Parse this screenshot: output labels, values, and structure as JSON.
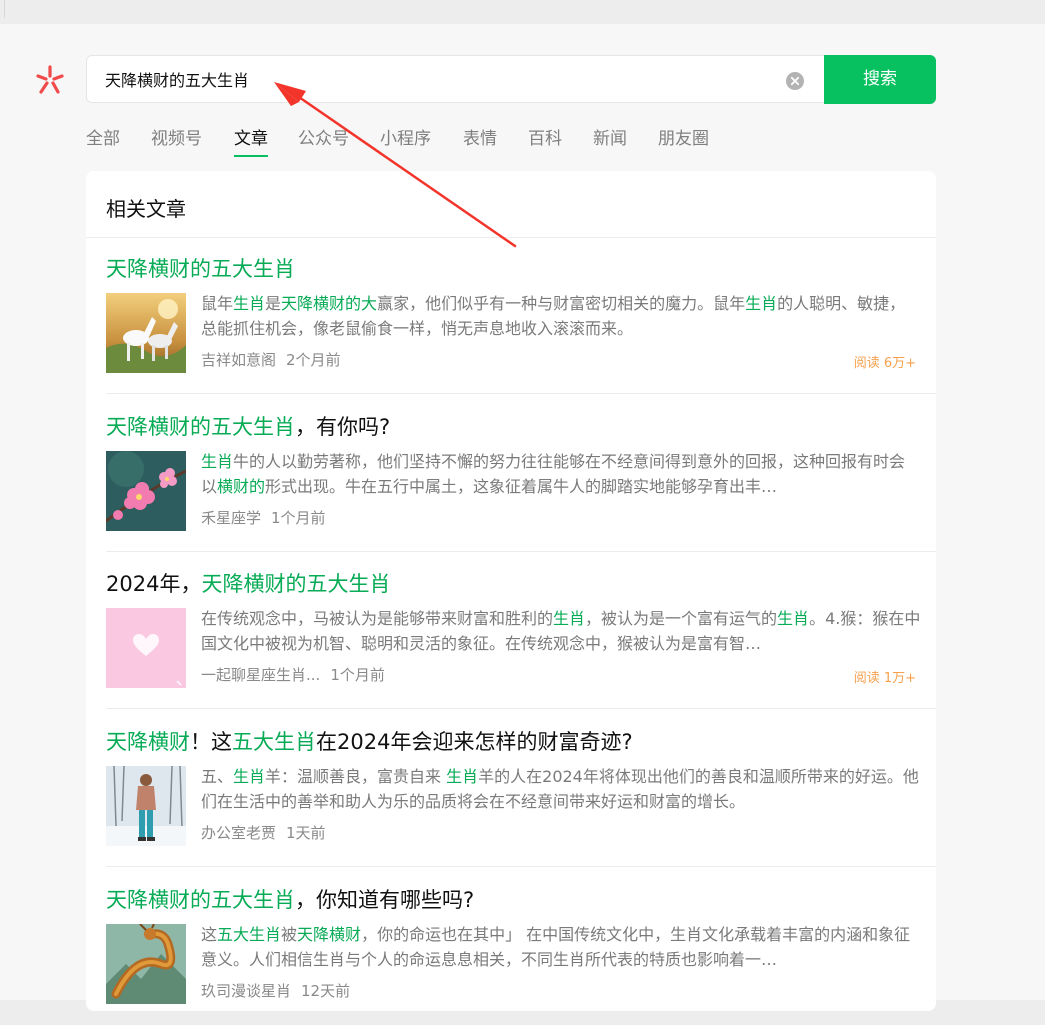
{
  "search": {
    "query": "天降横财的五大生肖",
    "button_label": "搜索"
  },
  "tabs": [
    {
      "label": "全部"
    },
    {
      "label": "视频号"
    },
    {
      "label": "文章"
    },
    {
      "label": "公众号"
    },
    {
      "label": "小程序"
    },
    {
      "label": "表情"
    },
    {
      "label": "百科"
    },
    {
      "label": "新闻"
    },
    {
      "label": "朋友圈"
    }
  ],
  "active_tab": "文章",
  "section": {
    "title": "相关文章"
  },
  "colors": {
    "accent": "#07c160",
    "highlight": "#07ab55",
    "read_count": "#f6a04d"
  },
  "results": [
    {
      "title": [
        {
          "t": "天降横财的五大生肖",
          "hl": true
        }
      ],
      "desc": [
        {
          "t": "鼠年",
          "hl": false
        },
        {
          "t": "生肖",
          "hl": true
        },
        {
          "t": "是",
          "hl": false
        },
        {
          "t": "天降横财的大",
          "hl": true
        },
        {
          "t": "赢家，他们似乎有一种与财富密切相关的魔力。鼠年",
          "hl": false
        },
        {
          "t": "生肖",
          "hl": true
        },
        {
          "t": "的人聪明、敏捷，总能抓住机会，像老鼠偷食一样，悄无声息地收入滚滚而来。",
          "hl": false
        }
      ],
      "source": "吉祥如意阁",
      "time": "2个月前",
      "read": "阅读 6万+",
      "thumb_icon": "white-horses-image"
    },
    {
      "title": [
        {
          "t": "天降横财的五大生肖",
          "hl": true
        },
        {
          "t": "，有你吗?",
          "hl": false
        }
      ],
      "desc": [
        {
          "t": "生肖",
          "hl": true
        },
        {
          "t": "牛的人以勤劳著称，他们坚持不懈的努力往往能够在不经意间得到意外的回报，这种回报有时会以",
          "hl": false
        },
        {
          "t": "横财的",
          "hl": true
        },
        {
          "t": "形式出现。牛在五行中属土，这象征着属牛人的脚踏实地能够孕育出丰…",
          "hl": false
        }
      ],
      "source": "禾星座学",
      "time": "1个月前",
      "read": "",
      "thumb_icon": "pink-blossom-image"
    },
    {
      "title": [
        {
          "t": "2024年，",
          "hl": false
        },
        {
          "t": "天降横财的五大生肖",
          "hl": true
        }
      ],
      "desc": [
        {
          "t": "在传统观念中，马被认为是能够带来财富和胜利的",
          "hl": false
        },
        {
          "t": "生肖",
          "hl": true
        },
        {
          "t": "，被认为是一个富有运气的",
          "hl": false
        },
        {
          "t": "生肖",
          "hl": true
        },
        {
          "t": "。4.猴：猴在中国文化中被视为机智、聪明和灵活的象征。在传统观念中，猴被认为是富有智…",
          "hl": false
        }
      ],
      "source": "一起聊星座生肖...",
      "time": "1个月前",
      "read": "阅读 1万+",
      "thumb_icon": "pink-heart-image"
    },
    {
      "title": [
        {
          "t": "天降横财",
          "hl": true
        },
        {
          "t": "！这",
          "hl": false
        },
        {
          "t": "五大生肖",
          "hl": true
        },
        {
          "t": "在2024年会迎来怎样的财富奇迹?",
          "hl": false
        }
      ],
      "desc": [
        {
          "t": "五、",
          "hl": false
        },
        {
          "t": "生肖",
          "hl": true
        },
        {
          "t": "羊：温顺善良，富贵自来 ",
          "hl": false
        },
        {
          "t": "生肖",
          "hl": true
        },
        {
          "t": "羊的人在2024年将体现出他们的善良和温顺所带来的好运。他们在生活中的善举和助人为乐的品质将会在不经意间带来好运和财富的增长。",
          "hl": false
        }
      ],
      "source": "办公室老贾",
      "time": "1天前",
      "read": "",
      "thumb_icon": "snow-person-image"
    },
    {
      "title": [
        {
          "t": "天降横财的五大生肖",
          "hl": true
        },
        {
          "t": "，你知道有哪些吗?",
          "hl": false
        }
      ],
      "desc": [
        {
          "t": "这",
          "hl": false
        },
        {
          "t": "五大生肖",
          "hl": true
        },
        {
          "t": "被",
          "hl": false
        },
        {
          "t": "天降横财",
          "hl": true
        },
        {
          "t": "，你的命运也在其中」 在中国传统文化中，生肖文化承载着丰富的内涵和象征意义。人们相信生肖与个人的命运息息相关，不同生肖所代表的特质也影响着一…",
          "hl": false
        }
      ],
      "source": "玖司漫谈星肖",
      "time": "12天前",
      "read": "",
      "thumb_icon": "dragon-image"
    }
  ]
}
